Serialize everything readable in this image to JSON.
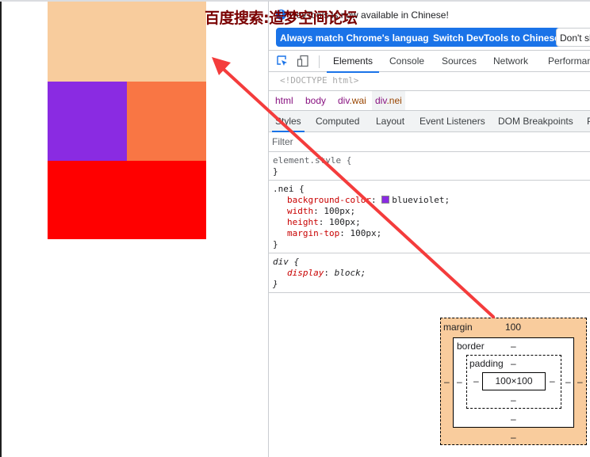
{
  "page": {
    "boxes": [
      {
        "name": "wai-box",
        "color": "#f8cc9d"
      },
      {
        "name": "nei-box",
        "color": "#8a2be2"
      },
      {
        "name": "side-box",
        "color": "#f97644"
      },
      {
        "name": "bottom-box",
        "color": "#ff0000"
      }
    ]
  },
  "annotation": {
    "watermark_text": "百度搜索:造梦空间论坛",
    "arrow_color": "#f43c3c"
  },
  "devtools": {
    "infobar": {
      "message": "DevTools is now available in Chinese!",
      "buttons": {
        "always_match": "Always match Chrome's language",
        "switch": "Switch DevTools to Chinese",
        "dont_show": "Don't show again"
      }
    },
    "tabs": [
      "Elements",
      "Console",
      "Sources",
      "Network",
      "Performance"
    ],
    "active_tab": "Elements",
    "dom_line": "<!DOCTYPE html>",
    "breadcrumbs": [
      {
        "tag": "html",
        "cls": ""
      },
      {
        "tag": "body",
        "cls": ""
      },
      {
        "tag": "div",
        "cls": ".wai"
      },
      {
        "tag": "div",
        "cls": ".nei"
      }
    ],
    "subtabs": [
      "Styles",
      "Computed",
      "Layout",
      "Event Listeners",
      "DOM Breakpoints",
      "Properties"
    ],
    "active_subtab": "Styles",
    "filter_placeholder": "Filter",
    "rules": {
      "element_style": {
        "selector": "element.style {",
        "close": "}"
      },
      "nei": {
        "selector": ".nei {",
        "decls": [
          {
            "prop": "background-color",
            "value": "blueviolet;",
            "swatch": "#8a2be2"
          },
          {
            "prop": "width",
            "value": "100px;"
          },
          {
            "prop": "height",
            "value": "100px;"
          },
          {
            "prop": "margin-top",
            "value": "100px;"
          }
        ],
        "close": "}"
      },
      "div_ua": {
        "selector": "div {",
        "decls": [
          {
            "prop": "display",
            "value": "block;"
          }
        ],
        "close": "}"
      }
    },
    "box_model": {
      "margin_label": "margin",
      "margin_top": "100",
      "margin_right": "–",
      "margin_bottom": "–",
      "margin_left": "–",
      "border_label": "border",
      "border_top": "–",
      "border_right": "–",
      "border_bottom": "–",
      "border_left": "–",
      "padding_label": "padding",
      "padding_top": "–",
      "padding_right": "–",
      "padding_bottom": "–",
      "padding_left": "–",
      "content": "100×100"
    }
  }
}
